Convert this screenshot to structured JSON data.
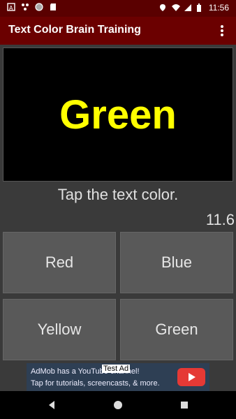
{
  "status_bar": {
    "time": "11:56"
  },
  "app_bar": {
    "title": "Text Color Brain Training"
  },
  "game": {
    "word": "Green",
    "word_color": "#ffff00",
    "instruction": "Tap the text color.",
    "timer": "11.6",
    "options": [
      "Red",
      "Blue",
      "Yellow",
      "Green"
    ]
  },
  "ad": {
    "line1": "AdMob has a YouTube channel!",
    "line2": "Tap for tutorials, screencasts, & more.",
    "badge": "Test Ad"
  },
  "icons": {
    "status_left": [
      "notification-a-icon",
      "signal-dots-icon",
      "circle-icon",
      "sd-card-icon"
    ],
    "status_right": [
      "location-icon",
      "wifi-icon",
      "cell-signal-icon",
      "battery-icon"
    ],
    "nav": [
      "back-icon",
      "home-icon",
      "recents-icon"
    ]
  }
}
